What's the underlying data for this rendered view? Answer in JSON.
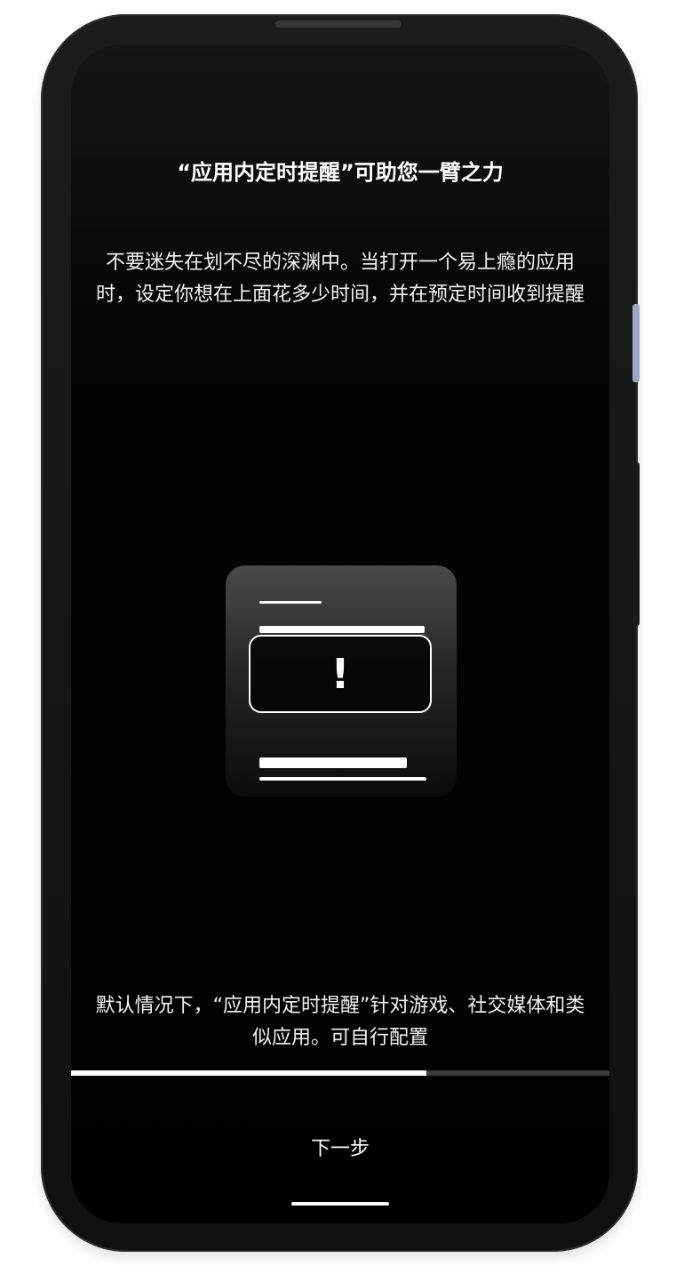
{
  "onboarding": {
    "title": "“应用内定时提醒”可助您一臂之力",
    "description": "不要迷失在划不尽的深渊中。当打开一个易上瘾的应用时，设定你想在上面花多少时间，并在预定时间收到提醒",
    "illustration": {
      "alert_glyph": "!"
    },
    "note": "默认情况下，“应用内定时提醒”针对游戏、社交媒体和类似应用。可自行配置",
    "progress_fraction": 0.66,
    "next_label": "下一步"
  }
}
